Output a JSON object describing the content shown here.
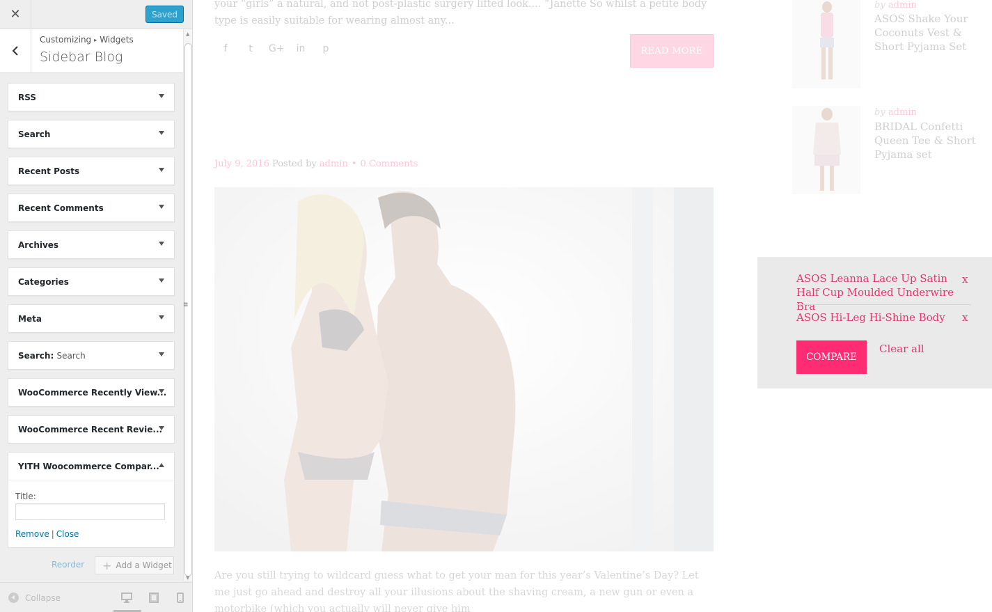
{
  "customizer": {
    "close_glyph": "✕",
    "saved_label": "Saved",
    "breadcrumb": {
      "root": "Customizing",
      "separator": "▸",
      "section": "Widgets"
    },
    "section_title": "Sidebar Blog",
    "widgets": [
      {
        "title": "RSS"
      },
      {
        "title": "Search"
      },
      {
        "title": "Recent Posts"
      },
      {
        "title": "Recent Comments"
      },
      {
        "title": "Archives"
      },
      {
        "title": "Categories"
      },
      {
        "title": "Meta"
      },
      {
        "title": "Search:",
        "subtitle": "Search"
      },
      {
        "title": "WooCommerce Recently View..."
      },
      {
        "title": "WooCommerce Recent Revie..."
      },
      {
        "title": "YITH Woocommerce Compar..."
      }
    ],
    "open_widget": {
      "title_label": "Title:",
      "title_value": "",
      "remove_label": "Remove",
      "separator": "|",
      "close_label": "Close"
    },
    "reorder_label": "Reorder",
    "add_widget_label": "Add a Widget",
    "collapse_label": "Collapse",
    "devices": [
      "desktop",
      "tablet",
      "mobile"
    ],
    "active_device": "desktop"
  },
  "preview": {
    "excerpt": "your “girls” a natural, and not post-plastic surgery lifted look.... “Janette So whilst a petite body type is easily suitable for wearing almost any...",
    "share_icons": [
      "f",
      "t",
      "G+",
      "in",
      "p"
    ],
    "read_more_label": "READ MORE",
    "post_meta": {
      "date": "July 9, 2016",
      "posted_by": "Posted by",
      "author": "admin",
      "dot": "•",
      "comments": "0 Comments"
    },
    "post_body": "Are you still trying to wildcard guess what to get your man for this year’s Valentine’s Day? Let me just go ahead and destroy all your illusions about the shaving cream, a new gun or even a motorbike (which you actually will never give him",
    "recent_products": [
      {
        "by": "by",
        "author": "admin",
        "title": "ASOS Shake Your Coconuts Vest & Short Pyjama Set"
      },
      {
        "by": "by",
        "author": "admin",
        "title": "BRIDAL Confetti Queen Tee & Short Pyjama set"
      }
    ],
    "compare": {
      "items": [
        {
          "name": "ASOS Leanna Lace Up Satin Half Cup Moulded Underwire Bra",
          "remove": "x"
        },
        {
          "name": "ASOS Hi-Leg Hi-Shine Body",
          "remove": "x"
        }
      ],
      "compare_label": "COMPARE",
      "clear_all_label": "Clear all"
    }
  },
  "colors": {
    "accent_blue": "#2ea2cc",
    "link_blue": "#0073aa",
    "brand_pink": "#ff2c74",
    "compare_text": "#e6346c"
  }
}
